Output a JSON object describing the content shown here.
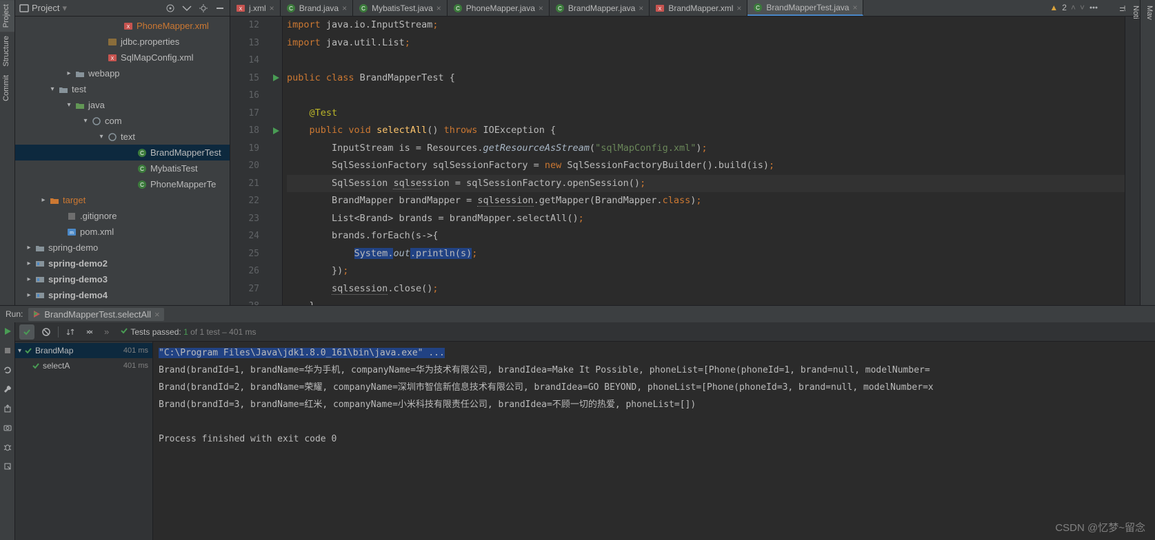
{
  "leftbar": {
    "items": [
      "Project",
      "Structure",
      "Commit"
    ],
    "active": 0
  },
  "project": {
    "title": "Project",
    "tree": [
      {
        "indent": 140,
        "icon": "xml",
        "label": "PhoneMapper.xml",
        "orange": true
      },
      {
        "indent": 117,
        "icon": "props",
        "label": "jdbc.properties"
      },
      {
        "indent": 117,
        "icon": "xml",
        "label": "SqlMapConfig.xml"
      },
      {
        "indent": 70,
        "chev": ">",
        "icon": "folder",
        "label": "webapp"
      },
      {
        "indent": 46,
        "chev": "v",
        "icon": "folder",
        "label": "test"
      },
      {
        "indent": 70,
        "chev": "v",
        "icon": "folder-green",
        "label": "java"
      },
      {
        "indent": 94,
        "chev": "v",
        "icon": "pkg",
        "label": "com"
      },
      {
        "indent": 117,
        "chev": "v",
        "icon": "pkg",
        "label": "text"
      },
      {
        "indent": 160,
        "icon": "class",
        "label": "BrandMapperTest",
        "selected": true
      },
      {
        "indent": 160,
        "icon": "class",
        "label": "MybatisTest"
      },
      {
        "indent": 160,
        "icon": "class",
        "label": "PhoneMapperTe"
      },
      {
        "indent": 33,
        "chev": ">",
        "icon": "folder-orange",
        "label": "target",
        "orange": true
      },
      {
        "indent": 58,
        "icon": "gitignore",
        "label": ".gitignore"
      },
      {
        "indent": 58,
        "icon": "maven",
        "label": "pom.xml"
      },
      {
        "indent": 12,
        "chev": ">",
        "icon": "folder",
        "label": "spring-demo"
      },
      {
        "indent": 12,
        "chev": ">",
        "icon": "module",
        "label": "spring-demo2",
        "bold": true
      },
      {
        "indent": 12,
        "chev": ">",
        "icon": "module",
        "label": "spring-demo3",
        "bold": true
      },
      {
        "indent": 12,
        "chev": ">",
        "icon": "module",
        "label": "spring-demo4",
        "bold": true
      }
    ]
  },
  "tabs": [
    {
      "icon": "xml",
      "label": "j.xml"
    },
    {
      "icon": "class",
      "label": "Brand.java"
    },
    {
      "icon": "class",
      "label": "MybatisTest.java"
    },
    {
      "icon": "class",
      "label": "PhoneMapper.java"
    },
    {
      "icon": "class",
      "label": "BrandMapper.java"
    },
    {
      "icon": "xml",
      "label": "BrandMapper.xml"
    },
    {
      "icon": "class",
      "label": "BrandMapperTest.java",
      "active": true
    }
  ],
  "editor_status": {
    "warnings": "2"
  },
  "code_lines": [
    {
      "n": 12,
      "html": "<span class='k-orange'>import</span> java.io.InputStream<span class='k-orange'>;</span>"
    },
    {
      "n": 13,
      "html": "<span class='k-orange'>import</span> java.util.List<span class='k-orange'>;</span>"
    },
    {
      "n": 14,
      "html": ""
    },
    {
      "n": 15,
      "html": "<span class='k-orange'>public class</span> BrandMapperTest {",
      "mark": "run"
    },
    {
      "n": 16,
      "html": ""
    },
    {
      "n": 17,
      "html": "    <span class='k-anno'>@Test</span>"
    },
    {
      "n": 18,
      "html": "    <span class='k-orange'>public void</span> <span class='k-yellow'>selectAll</span>() <span class='k-orange'>throws</span> IOException {",
      "mark": "run"
    },
    {
      "n": 19,
      "html": "        InputStream is = Resources.<span class='k-italic'>getResourceAsStream</span>(<span class='k-string'>\"sqlMapConfig.xml\"</span>)<span class='k-orange'>;</span>"
    },
    {
      "n": 20,
      "html": "        SqlSessionFactory sqlSessionFactory = <span class='k-orange'>new</span> SqlSessionFactoryBuilder().build(is)<span class='k-orange'>;</span>"
    },
    {
      "n": 21,
      "html": "        SqlSession <span class='underline'>sqlse</span>ssion = sqlSessionFactory.openSession()<span class='k-orange'>;</span>",
      "hl": true
    },
    {
      "n": 22,
      "html": "        BrandMapper brandMapper = <span class='underline'>sqlsession</span>.getMapper(BrandMapper.<span class='k-orange'>class</span>)<span class='k-orange'>;</span>"
    },
    {
      "n": 23,
      "html": "        List&lt;Brand&gt; brands = brandMapper.selectAll()<span class='k-orange'>;</span>"
    },
    {
      "n": 24,
      "html": "        brands.forEach(s-&gt;{"
    },
    {
      "n": 25,
      "html": "            <span class='boxed'>System.</span><span class='k-purple k-italic'>out</span><span class='boxed'>.println(s)</span><span class='k-orange'>;</span>"
    },
    {
      "n": 26,
      "html": "        })<span class='k-orange'>;</span>"
    },
    {
      "n": 27,
      "html": "        <span class='underline'>sqlsession</span>.close()<span class='k-orange'>;</span>"
    },
    {
      "n": 28,
      "html": "    }"
    }
  ],
  "right_labels": [
    "Mav",
    "Noti",
    "Ti"
  ],
  "run": {
    "label": "Run:",
    "tab": "BrandMapperTest.selectAll",
    "status_prefix": "Tests passed:",
    "status_count": "1",
    "status_suffix": "of 1 test – 401 ms",
    "tree": [
      {
        "chev": "v",
        "pass": true,
        "label": "BrandMap",
        "time": "401 ms",
        "selected": true
      },
      {
        "indent": 20,
        "pass": true,
        "label": "selectA",
        "time": "401 ms"
      }
    ],
    "console": [
      "\"C:\\Program Files\\Java\\jdk1.8.0_161\\bin\\java.exe\" ...",
      "Brand(brandId=1, brandName=华为手机, companyName=华为技术有限公司, brandIdea=Make It Possible, phoneList=[Phone(phoneId=1, brand=null, modelNumber=",
      "Brand(brandId=2, brandName=荣耀, companyName=深圳市智信新信息技术有限公司, brandIdea=GO BEYOND, phoneList=[Phone(phoneId=3, brand=null, modelNumber=x",
      "Brand(brandId=3, brandName=红米, companyName=小米科技有限责任公司, brandIdea=不顾一切的热爱, phoneList=[])",
      "",
      "Process finished with exit code 0"
    ]
  },
  "watermark": "CSDN @忆梦~留念"
}
